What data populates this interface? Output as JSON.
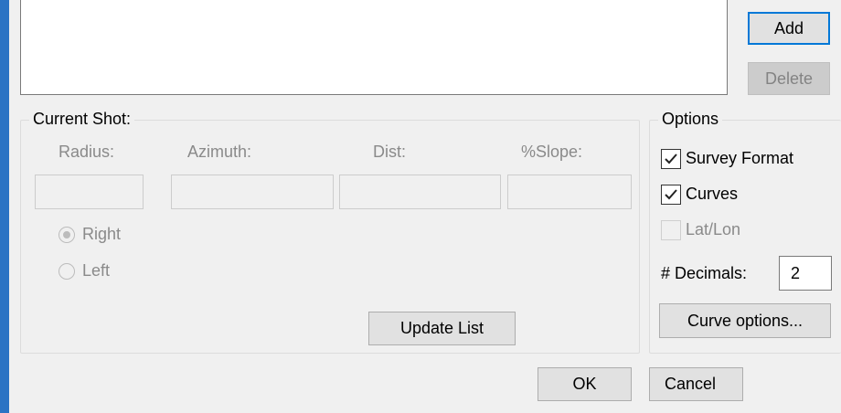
{
  "list_buttons": {
    "add": "Add",
    "delete": "Delete"
  },
  "current_shot": {
    "title": "Current Shot:",
    "columns": [
      "Radius:",
      "Azimuth:",
      "Dist:",
      "%Slope:"
    ],
    "fields": [
      "",
      "",
      "",
      ""
    ],
    "radio_right": "Right",
    "radio_left": "Left",
    "radio_selected": "Right",
    "update_button": "Update List"
  },
  "options": {
    "title": "Options",
    "survey_format": {
      "label": "Survey Format",
      "checked": true
    },
    "curves": {
      "label": "Curves",
      "checked": true
    },
    "lat_lon": {
      "label": "Lat/Lon",
      "checked": false,
      "enabled": false
    },
    "decimals_label": "# Decimals:",
    "decimals_value": "2",
    "curve_options_button": "Curve options..."
  },
  "dialog_buttons": {
    "ok": "OK",
    "cancel": "Cancel"
  }
}
